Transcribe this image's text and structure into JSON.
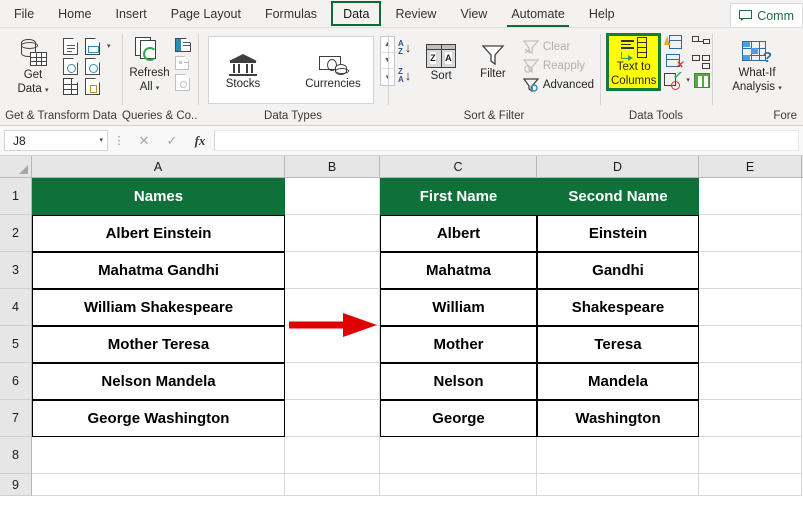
{
  "window": {
    "tabs": [
      {
        "label": "File",
        "active": false
      },
      {
        "label": "Home",
        "active": false
      },
      {
        "label": "Insert",
        "active": false
      },
      {
        "label": "Page Layout",
        "active": false
      },
      {
        "label": "Formulas",
        "active": false
      },
      {
        "label": "Data",
        "active": true
      },
      {
        "label": "Review",
        "active": false
      },
      {
        "label": "View",
        "active": false
      },
      {
        "label": "Automate",
        "active": false
      },
      {
        "label": "Help",
        "active": false
      }
    ],
    "comments_label": "Comm",
    "comments_icon": "comment-bubble-icon"
  },
  "ribbon": {
    "groups": [
      {
        "id": "get-transform",
        "label": "Get & Transform Data",
        "big": {
          "label_line1": "Get",
          "label_line2": "Data",
          "icon": "get-data-icon",
          "has_caret": true
        },
        "small": [
          {
            "icon": "from-text-csv-icon"
          },
          {
            "icon": "from-web-icon",
            "has_caret": true
          },
          {
            "icon": "from-table-range-icon"
          },
          {
            "icon": "recent-sources-icon"
          },
          {
            "icon": "from-other-sources-icon"
          },
          {
            "icon": "existing-connections-icon"
          }
        ]
      },
      {
        "id": "queries-connections",
        "label": "Queries & Co...",
        "big": {
          "label_line1": "Refresh",
          "label_line2": "All",
          "icon": "refresh-all-icon",
          "has_caret": true
        },
        "small": [
          {
            "icon": "queries-pane-icon"
          },
          {
            "icon": "properties-icon",
            "dim": true
          },
          {
            "icon": "edit-links-icon",
            "dim": true
          }
        ]
      },
      {
        "id": "data-types",
        "label": "Data Types",
        "items": [
          {
            "label": "Stocks",
            "icon": "stocks-icon"
          },
          {
            "label": "Currencies",
            "icon": "currencies-icon"
          }
        ],
        "spinner": [
          "▲",
          "▼",
          "▾"
        ]
      },
      {
        "id": "sort-filter",
        "label": "Sort & Filter",
        "sort_asc_icon": "sort-a-to-z-icon",
        "sort_desc_icon": "sort-z-to-a-icon",
        "items": [
          {
            "label": "Sort",
            "icon": "sort-icon"
          },
          {
            "label": "Filter",
            "icon": "filter-icon"
          }
        ],
        "small": [
          {
            "label": "Clear",
            "icon": "clear-filter-icon",
            "dim": true
          },
          {
            "label": "Reapply",
            "icon": "reapply-filter-icon",
            "dim": true
          },
          {
            "label": "Advanced",
            "icon": "advanced-filter-icon",
            "dim": false
          }
        ]
      },
      {
        "id": "data-tools",
        "label": "Data Tools",
        "highlight": {
          "label_line1": "Text to",
          "label_line2": "Columns",
          "icon": "text-to-columns-icon",
          "highlight_fill": "#ffff00",
          "highlight_border": "#157a3a"
        },
        "small": [
          {
            "icon": "flash-fill-icon"
          },
          {
            "icon": "relationships-icon"
          },
          {
            "icon": "remove-duplicates-icon"
          },
          {
            "icon": "manage-data-model-icon"
          },
          {
            "icon": "data-validation-icon",
            "has_caret": true
          },
          {
            "icon": "consolidate-icon"
          }
        ]
      },
      {
        "id": "forecast",
        "label": "Fore",
        "big": {
          "label_line1": "What-If",
          "label_line2": "Analysis",
          "icon": "what-if-analysis-icon",
          "has_caret": true
        }
      }
    ]
  },
  "formula_bar": {
    "name_box_value": "J8",
    "name_box_caret": "▾",
    "cancel_icon": "cancel-icon",
    "confirm_icon": "confirm-checkmark-icon",
    "function_icon": "insert-function-fx-icon",
    "formula_value": ""
  },
  "grid": {
    "columns": [
      "A",
      "B",
      "C",
      "D",
      "E"
    ],
    "rows": [
      "1",
      "2",
      "3",
      "4",
      "5",
      "6",
      "7",
      "8",
      "9"
    ],
    "header_fill": "#10703a",
    "header_text_color": "#ffffff",
    "arrow_color": "#e00000",
    "arrow_icon": "red-right-arrow-annotation",
    "table_a": {
      "header": "Names",
      "values": [
        "Albert Einstein",
        "Mahatma Gandhi",
        "William Shakespeare",
        "Mother Teresa",
        "Nelson Mandela",
        "George Washington"
      ]
    },
    "table_c": {
      "header": "First Name",
      "values": [
        "Albert",
        "Mahatma",
        "William",
        "Mother",
        "Nelson",
        "George"
      ]
    },
    "table_d": {
      "header": "Second Name",
      "values": [
        "Einstein",
        "Gandhi",
        "Shakespeare",
        "Teresa",
        "Mandela",
        "Washington"
      ]
    }
  }
}
